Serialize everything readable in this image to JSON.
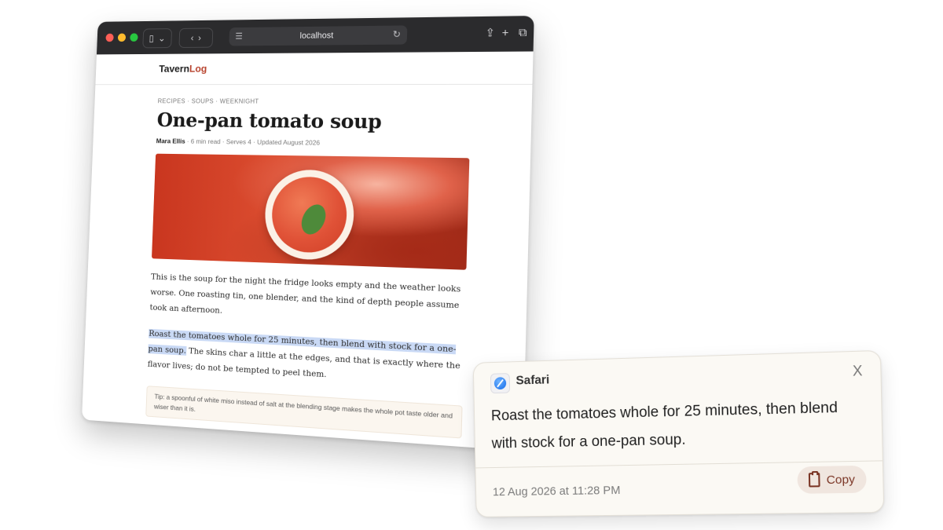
{
  "browser": {
    "url": "localhost",
    "site": {
      "logo_part1": "Tavern",
      "logo_part2": "Log"
    },
    "article": {
      "breadcrumb": "RECIPES · SOUPS · WEEKNIGHT",
      "title": "One-pan tomato soup",
      "author": "Mara Ellis",
      "meta": " · 6 min read · Serves 4 · Updated August 2026",
      "paragraph1": "This is the soup for the night the fridge looks empty and the weather looks worse. One roasting tin, one blender, and the kind of depth people assume took an afternoon.",
      "paragraph2_highlight": "Roast the tomatoes whole for 25 minutes, then blend with stock for a one-pan soup.",
      "paragraph2_rest": " The skins char a little at the edges, and that is exactly where the flavor lives; do not be tempted to peel them.",
      "tip": "Tip: a spoonful of white miso instead of salt at the blending stage makes the whole pot taste older and wiser than it is."
    }
  },
  "notification": {
    "app_name": "Safari",
    "close_label": "X",
    "text": "Roast the tomatoes whole for 25 minutes, then blend with stock for a one-pan soup.",
    "timestamp": "12 Aug 2026 at 11:28 PM",
    "copy_label": "Copy"
  },
  "colors": {
    "accent": "#b8442f",
    "highlight": "#c9d9f5",
    "copy_text": "#7a3424"
  }
}
